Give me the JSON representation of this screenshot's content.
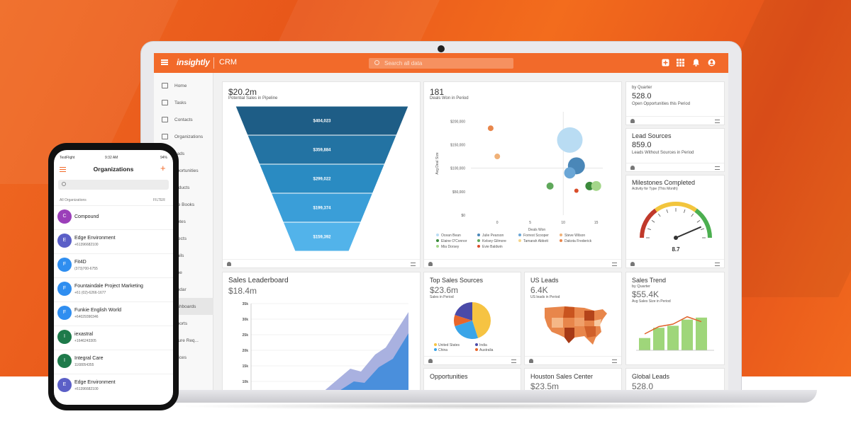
{
  "topbar": {
    "logo": "insightly",
    "product": "CRM",
    "search_placeholder": "Search all data"
  },
  "sidebar": {
    "items": [
      {
        "label": "Home"
      },
      {
        "label": "Tasks"
      },
      {
        "label": "Contacts"
      },
      {
        "label": "Organizations"
      },
      {
        "label": "eads"
      },
      {
        "label": "pportunities"
      },
      {
        "label": "roducts"
      },
      {
        "label": "ice Books"
      },
      {
        "label": "uotes"
      },
      {
        "label": "ojects"
      },
      {
        "label": "nails"
      },
      {
        "label": "one"
      },
      {
        "label": "endar"
      },
      {
        "label": "ashboards"
      },
      {
        "label": "eports"
      },
      {
        "label": "ature Req..."
      },
      {
        "label": "rvices"
      }
    ]
  },
  "cards": {
    "pipeline": {
      "value": "$20.2m",
      "subtitle": "Potential Sales in Pipeline"
    },
    "deals": {
      "value": "181",
      "subtitle": "Deals Won in Period"
    },
    "by_quarter": {
      "title": "by Quarter",
      "value": "528.0",
      "subtitle": "Open Opportunities this Period"
    },
    "lead_sources": {
      "title": "Lead Sources",
      "value": "859.0",
      "subtitle": "Leads Without Sources in Period"
    },
    "milestones": {
      "title": "Milestones Completed",
      "subtitle": "Activity for Type (This Month)",
      "value": "8.7"
    },
    "leaderboard": {
      "title": "Sales Leaderboard",
      "value": "$18.4m"
    },
    "top_sources": {
      "title": "Top Sales Sources",
      "value": "$23.6m",
      "subtitle": "Sales in Period"
    },
    "us_leads": {
      "title": "US Leads",
      "value": "6.4K",
      "subtitle": "US leads in Period"
    },
    "sales_trend": {
      "title": "Sales Trend",
      "by": "by Quarter",
      "value": "$55.4K",
      "subtitle": "Avg Sales Size in Period"
    },
    "opportunities": {
      "title": "Opportunities"
    },
    "houston": {
      "title": "Houston Sales Center",
      "value": "$23.5m"
    },
    "global_leads": {
      "title": "Global Leads",
      "value": "528.0"
    }
  },
  "chart_data": [
    {
      "type": "funnel",
      "title": "$20.2m",
      "values": [
        404023,
        359884,
        299022,
        199374,
        159392
      ],
      "labels": [
        "$404,023",
        "$359,884",
        "$299,022",
        "$199,374",
        "$159,392"
      ]
    },
    {
      "type": "scatter",
      "title": "181",
      "xlabel": "Deals Won",
      "ylabel": "Avg Deal Size",
      "x_ticks": [
        "0",
        "5",
        "10",
        "15"
      ],
      "y_ticks": [
        "$200,000",
        "$150,000",
        "$100,000",
        "$50,000",
        "$0"
      ],
      "points": [
        {
          "x": -1,
          "y": 185000,
          "r": 4,
          "color": "#e8864b"
        },
        {
          "x": 0,
          "y": 125000,
          "r": 4,
          "color": "#f0b178"
        },
        {
          "x": 11,
          "y": 160000,
          "r": 18,
          "color": "#b9dcf3"
        },
        {
          "x": 12,
          "y": 105000,
          "r": 12,
          "color": "#4a87b8"
        },
        {
          "x": 11,
          "y": 90000,
          "r": 8,
          "color": "#6aa6d6"
        },
        {
          "x": 8,
          "y": 62000,
          "r": 5,
          "color": "#5fa85b"
        },
        {
          "x": 14,
          "y": 62000,
          "r": 6,
          "color": "#3b8a3b"
        },
        {
          "x": 15,
          "y": 62000,
          "r": 7,
          "color": "#a4d68a"
        },
        {
          "x": 12,
          "y": 52000,
          "r": 3,
          "color": "#d94d2a"
        }
      ],
      "legend": [
        {
          "name": "Ocean Bean",
          "color": "#b9dcf3"
        },
        {
          "name": "Julie Pearson",
          "color": "#4a87b8"
        },
        {
          "name": "Forrest Scooper",
          "color": "#6aa6d6"
        },
        {
          "name": "Steve Wilson",
          "color": "#f0b178"
        },
        {
          "name": "Elaine O'Connor",
          "color": "#3b8a3b"
        },
        {
          "name": "Kelsey Gilmore",
          "color": "#5fa85b"
        },
        {
          "name": "Tamarah Abbott",
          "color": "#f5d58a"
        },
        {
          "name": "Dakota Frederick",
          "color": "#e8864b"
        },
        {
          "name": "Mia Dorsey",
          "color": "#a4d68a"
        },
        {
          "name": "Evie Baldwin",
          "color": "#d94d2a"
        }
      ]
    },
    {
      "type": "gauge",
      "value": 8.7,
      "min": 0,
      "max": 10
    },
    {
      "type": "area",
      "title": "Sales Leaderboard",
      "y_ticks": [
        "35k",
        "30k",
        "25k",
        "20k",
        "15k",
        "10k"
      ]
    },
    {
      "type": "pie",
      "title": "Top Sales Sources",
      "slices": [
        {
          "name": "United States",
          "value": 45,
          "color": "#f6c342"
        },
        {
          "name": "India",
          "value": 20,
          "color": "#4a4aa8"
        },
        {
          "name": "China",
          "value": 25,
          "color": "#3aa5e8"
        },
        {
          "name": "Australia",
          "value": 10,
          "color": "#e8662a"
        }
      ]
    },
    {
      "type": "bar",
      "title": "Sales Trend",
      "values": [
        30,
        55,
        60,
        75,
        80
      ],
      "trend": [
        40,
        58,
        64,
        82,
        70
      ]
    }
  ],
  "phone": {
    "status": {
      "carrier": "TestFlight",
      "time": "9:32 AM",
      "battery": "94%"
    },
    "title": "Organizations",
    "section": "All Organizations",
    "filter": "FILTER",
    "rows": [
      {
        "initial": "C",
        "name": "Compound",
        "phone": "",
        "color": "#9b3fb9"
      },
      {
        "initial": "E",
        "name": "Edge Environment",
        "phone": "+61396682100",
        "color": "#5b5fc7"
      },
      {
        "initial": "F",
        "name": "Fit4D",
        "phone": "(373)700-6755",
        "color": "#2f8ef0"
      },
      {
        "initial": "F",
        "name": "Fountaindale Project Marketing",
        "phone": "+61 (02)-6266-1677",
        "color": "#2f8ef0"
      },
      {
        "initial": "F",
        "name": "Funkie English World",
        "phone": "+64029390346",
        "color": "#2f8ef0"
      },
      {
        "initial": "I",
        "name": "iexastral",
        "phone": "+1646243305",
        "color": "#1e7a4a"
      },
      {
        "initial": "I",
        "name": "Integral Care",
        "phone": "1168054355",
        "color": "#1e7a4a"
      },
      {
        "initial": "E",
        "name": "Edge Environment",
        "phone": "+61396682100",
        "color": "#5b5fc7"
      }
    ]
  }
}
